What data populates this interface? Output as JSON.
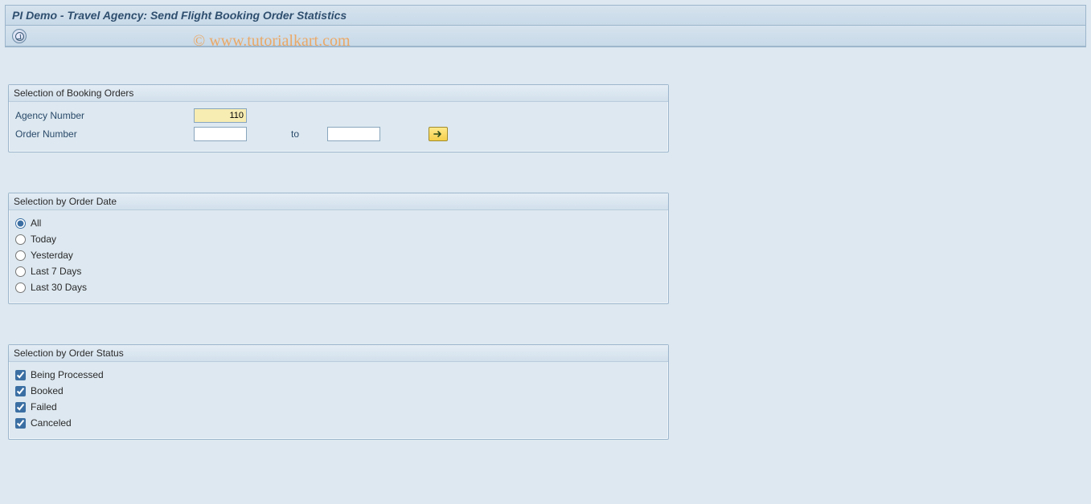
{
  "title": "PI Demo - Travel Agency: Send Flight Booking Order Statistics",
  "watermark": "© www.tutorialkart.com",
  "booking_group": {
    "title": "Selection of Booking Orders",
    "agency_label": "Agency Number",
    "agency_value": "110",
    "order_label": "Order Number",
    "order_from": "",
    "to_label": "to",
    "order_to": ""
  },
  "date_group": {
    "title": "Selection by Order Date",
    "options": {
      "all": "All",
      "today": "Today",
      "yesterday": "Yesterday",
      "last7": "Last 7 Days",
      "last30": "Last 30 Days"
    }
  },
  "status_group": {
    "title": "Selection by Order Status",
    "options": {
      "processing": "Being Processed",
      "booked": "Booked",
      "failed": "Failed",
      "canceled": "Canceled"
    }
  }
}
